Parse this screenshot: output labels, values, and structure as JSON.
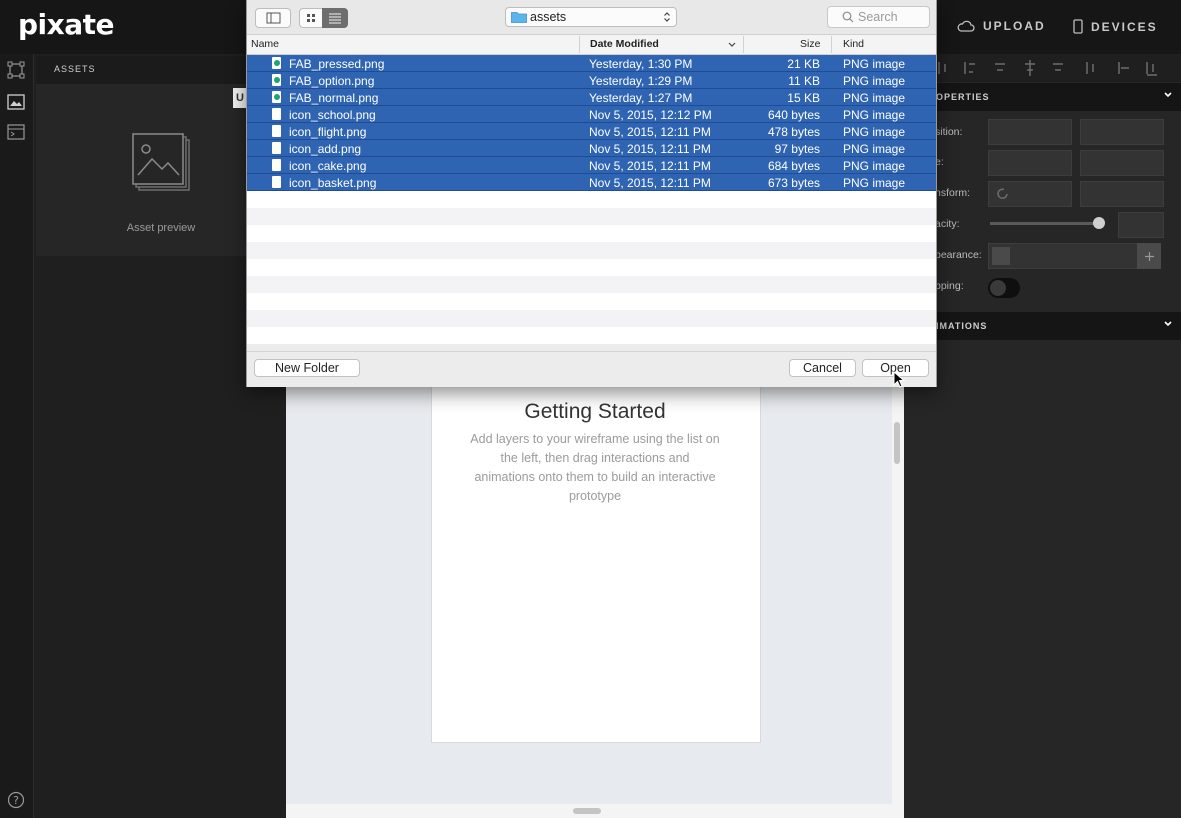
{
  "app": {
    "logo": "pixate",
    "upload_label": "UPLOAD",
    "devices_label": "DEVICES"
  },
  "left_panel": {
    "title": "ASSETS",
    "preview_label": "Asset preview",
    "tooltip_fragment": "U"
  },
  "canvas": {
    "title": "Getting Started",
    "body": "Add layers to your wireframe using the list on the left, then drag interactions and animations onto them to build an interactive prototype"
  },
  "properties": {
    "section_title": "OPERTIES",
    "labels": [
      "sition:",
      "e:",
      "nsform:",
      "acity:",
      "pearance:",
      "pping:"
    ],
    "animations_title": "IMATIONS"
  },
  "dialog": {
    "path": "assets",
    "search_placeholder": "Search",
    "columns": {
      "name": "Name",
      "date": "Date Modified",
      "size": "Size",
      "kind": "Kind"
    },
    "files": [
      {
        "name": "FAB_pressed.png",
        "date": "Yesterday, 1:30 PM",
        "size": "21 KB",
        "kind": "PNG image",
        "icon": "image-thumb-icon"
      },
      {
        "name": "FAB_option.png",
        "date": "Yesterday, 1:29 PM",
        "size": "11 KB",
        "kind": "PNG image",
        "icon": "image-thumb-icon"
      },
      {
        "name": "FAB_normal.png",
        "date": "Yesterday, 1:27 PM",
        "size": "15 KB",
        "kind": "PNG image",
        "icon": "image-thumb-icon"
      },
      {
        "name": "icon_school.png",
        "date": "Nov 5, 2015, 12:12 PM",
        "size": "640 bytes",
        "kind": "PNG image",
        "icon": "blank-file-icon"
      },
      {
        "name": "icon_flight.png",
        "date": "Nov 5, 2015, 12:11 PM",
        "size": "478 bytes",
        "kind": "PNG image",
        "icon": "blank-file-icon"
      },
      {
        "name": "icon_add.png",
        "date": "Nov 5, 2015, 12:11 PM",
        "size": "97 bytes",
        "kind": "PNG image",
        "icon": "blank-file-icon"
      },
      {
        "name": "icon_cake.png",
        "date": "Nov 5, 2015, 12:11 PM",
        "size": "684 bytes",
        "kind": "PNG image",
        "icon": "blank-file-icon"
      },
      {
        "name": "icon_basket.png",
        "date": "Nov 5, 2015, 12:11 PM",
        "size": "673 bytes",
        "kind": "PNG image",
        "icon": "blank-file-icon"
      }
    ],
    "new_folder_label": "New Folder",
    "cancel_label": "Cancel",
    "open_label": "Open"
  },
  "colors": {
    "selection": "#2f64b3",
    "app_dark": "#1f1f1f",
    "icon_green": "#22a07a"
  }
}
